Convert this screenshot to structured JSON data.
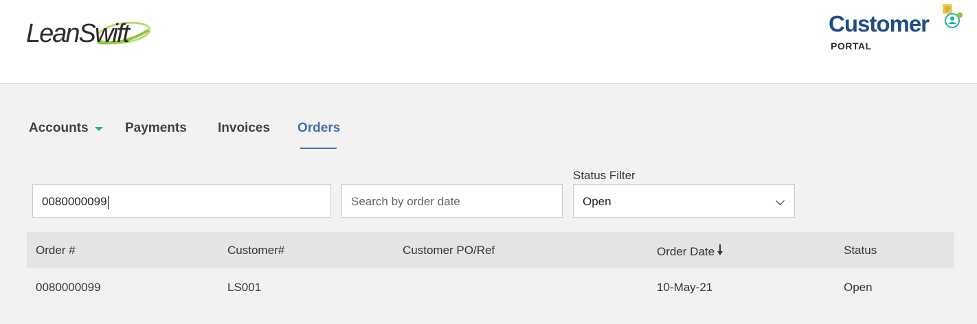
{
  "header": {
    "brand_left": "LeanSwift",
    "brand_right_word": "Customer",
    "brand_right_sub": "PORTAL",
    "colors": {
      "brand_blue": "#1f4e86",
      "swoosh_green": "#8cc63f",
      "accent_teal": "#1ab0a0",
      "active_tab": "#4a6ea8"
    }
  },
  "nav": {
    "items": [
      {
        "label": "Accounts",
        "has_dropdown": true,
        "icon": "caret-down-icon"
      },
      {
        "label": "Payments"
      },
      {
        "label": "Invoices"
      },
      {
        "label": "Orders",
        "active": true
      }
    ]
  },
  "filters": {
    "order_search_value": "0080000099",
    "date_search_placeholder": "Search by order date",
    "status_label": "Status Filter",
    "status_selected": "Open"
  },
  "table": {
    "columns": [
      "Order #",
      "Customer#",
      "Customer PO/Ref",
      "Order Date",
      "Status"
    ],
    "sort_icon": "arrow-down-icon",
    "rows": [
      {
        "order": "0080000099",
        "customer": "LS001",
        "po_ref": "",
        "order_date": "10-May-21",
        "status": "Open"
      }
    ]
  }
}
